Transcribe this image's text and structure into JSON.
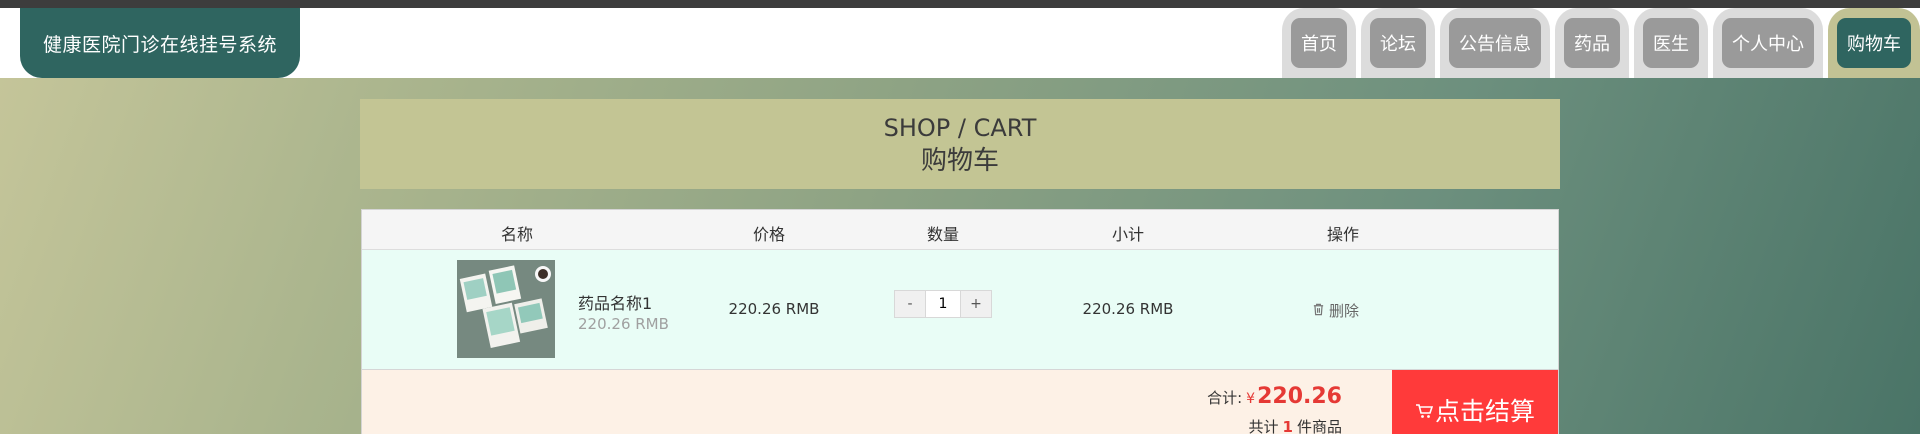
{
  "header": {
    "logo_title": "健康医院门诊在线挂号系统",
    "nav": [
      {
        "label": "首页"
      },
      {
        "label": "论坛"
      },
      {
        "label": "公告信息"
      },
      {
        "label": "药品"
      },
      {
        "label": "医生"
      },
      {
        "label": "个人中心"
      },
      {
        "label": "购物车",
        "active": true
      }
    ]
  },
  "page_title": {
    "en": "SHOP / CART",
    "cn": "购物车"
  },
  "cart": {
    "columns": {
      "name": "名称",
      "price": "价格",
      "quantity": "数量",
      "subtotal": "小计",
      "action": "操作"
    },
    "items": [
      {
        "name": "药品名称1",
        "unit_price": "220.26 RMB",
        "price": "220.26 RMB",
        "quantity": "1",
        "subtotal": "220.26 RMB",
        "decrement": "-",
        "increment": "+",
        "delete_label": "删除"
      }
    ],
    "summary": {
      "total_label": "合计:",
      "currency": "¥",
      "total_amount": "220.26",
      "count_prefix": "共计",
      "count": "1",
      "count_suffix": "件商品"
    },
    "checkout_label": "点击结算"
  },
  "colors": {
    "brand": "#2f6560",
    "title_band": "#c3c594",
    "row_bg": "#e9fdf6",
    "footer_bg": "#fdf1e6",
    "accent_red": "#ff3a3a"
  },
  "icons": [
    "trash-icon",
    "cart-icon",
    "product-thumbnail"
  ]
}
